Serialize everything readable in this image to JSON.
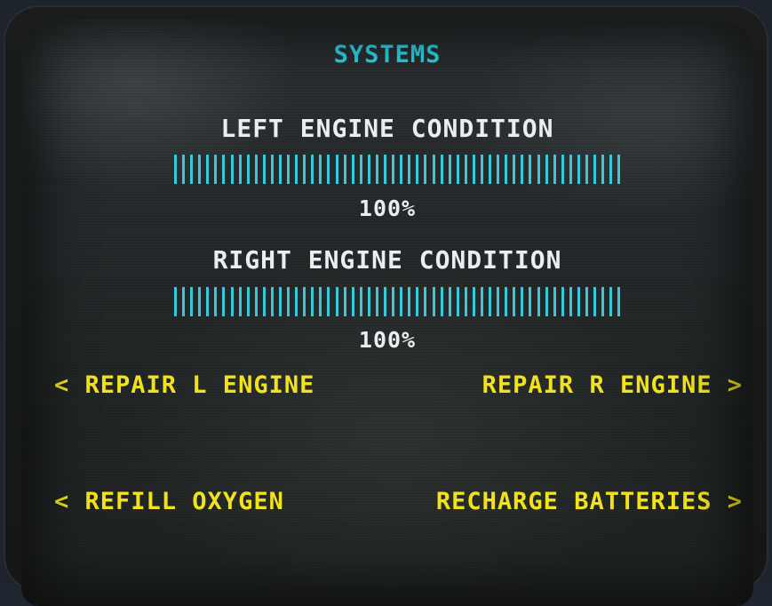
{
  "screen": {
    "title": "SYSTEMS"
  },
  "left_engine": {
    "label": "LEFT ENGINE CONDITION",
    "percent_text": "100%",
    "level": 1.0
  },
  "right_engine": {
    "label": "RIGHT ENGINE CONDITION",
    "percent_text": "100%",
    "level": 1.0
  },
  "actions": {
    "repair_left": "< REPAIR L ENGINE",
    "repair_right": "REPAIR R ENGINE >",
    "refill_oxygen": "< REFILL OXYGEN",
    "recharge_batteries": "RECHARGE BATTERIES >"
  },
  "colors": {
    "title": "#2ad4e6",
    "bar": "#36c9d8",
    "label": "#e9eef0",
    "action": "#f2e21a"
  }
}
